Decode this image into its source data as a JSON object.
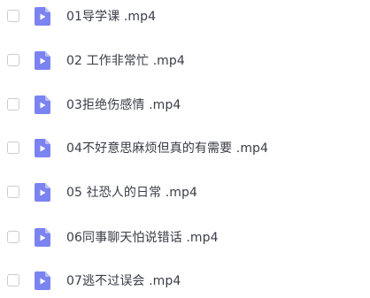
{
  "colors": {
    "video_icon_fill": "#7b83f0",
    "video_icon_fold": "#b7bdf7",
    "play_triangle": "#ffffff",
    "checkbox_border": "#c9ccd6",
    "text": "#3a3d47"
  },
  "files": [
    {
      "name": "01导学课 .mp4",
      "icon": "video-file-icon",
      "selected": false
    },
    {
      "name": "02 工作非常忙 .mp4",
      "icon": "video-file-icon",
      "selected": false
    },
    {
      "name": "03拒绝伤感情 .mp4",
      "icon": "video-file-icon",
      "selected": false
    },
    {
      "name": "04不好意思麻烦但真的有需要 .mp4",
      "icon": "video-file-icon",
      "selected": false
    },
    {
      "name": "05 社恐人的日常 .mp4",
      "icon": "video-file-icon",
      "selected": false
    },
    {
      "name": "06同事聊天怕说错话 .mp4",
      "icon": "video-file-icon",
      "selected": false
    },
    {
      "name": "07逃不过误会 .mp4",
      "icon": "video-file-icon",
      "selected": false
    }
  ]
}
